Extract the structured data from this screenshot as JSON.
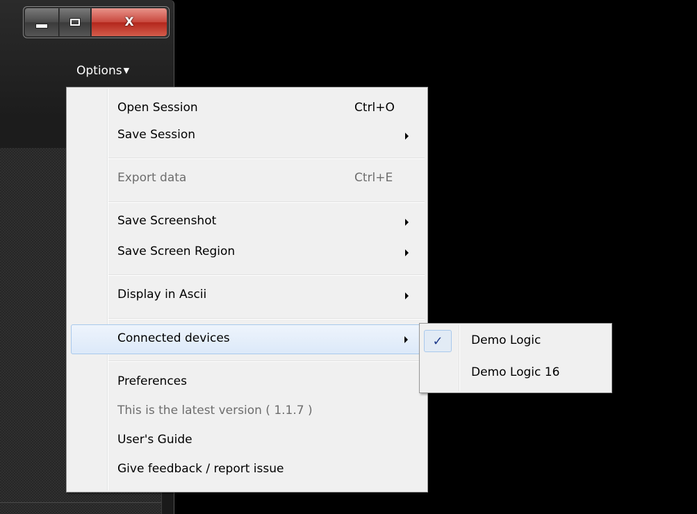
{
  "app": {
    "options_label": "Options",
    "options_arrow": "▼",
    "caption": {
      "minimize_icon": "minimize-icon",
      "maximize_icon": "maximize-icon",
      "close_glyph": "X"
    }
  },
  "menu": {
    "items": [
      {
        "label": "Open Session",
        "shortcut": "Ctrl+O"
      },
      {
        "label": "Save Session",
        "submenu": true
      },
      {
        "label": "Export data",
        "shortcut": "Ctrl+E",
        "disabled": true
      },
      {
        "label": "Save Screenshot",
        "submenu": true
      },
      {
        "label": "Save Screen Region",
        "submenu": true
      },
      {
        "label": "Display in Ascii",
        "submenu": true
      },
      {
        "label": "Connected devices",
        "submenu": true,
        "highlighted": true
      },
      {
        "label": "Preferences"
      },
      {
        "label": "This is the latest version ( 1.1.7 )",
        "disabled": true
      },
      {
        "label": "User's Guide"
      },
      {
        "label": "Give feedback / report issue"
      }
    ]
  },
  "submenu": {
    "items": [
      {
        "label": "Demo Logic",
        "checked": true
      },
      {
        "label": "Demo Logic 16",
        "checked": false
      }
    ],
    "check_glyph": "✓"
  },
  "colors": {
    "menu_bg": "#f0f0f0",
    "highlight_border": "#a8c8ec",
    "close_button": "#c8473c",
    "disabled_text": "#6d6d6d"
  }
}
